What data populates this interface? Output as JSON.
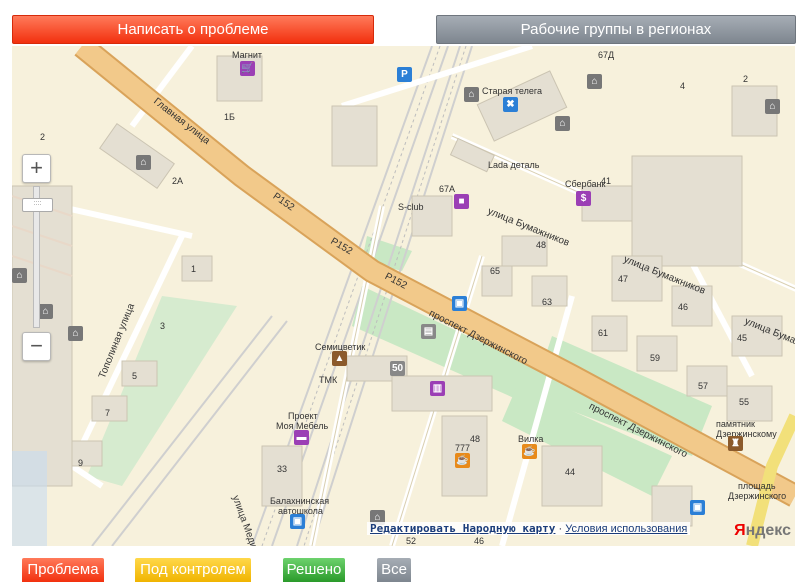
{
  "header": {
    "report_button": "Написать о проблеме",
    "groups_button": "Рабочие группы в регионах"
  },
  "map": {
    "places": {
      "magnit": "Магнит",
      "staraya_telega": "Старая телега",
      "lada": "Lada деталь",
      "sberbank": "Сбербанк",
      "sclub": "S-club",
      "semitsvetik": "Семицветик",
      "tmk": "ТМК",
      "proekt": "Проект",
      "moya_mebel": "Моя Мебель",
      "vilka": "Вилка",
      "avtoshkola_1": "Балахнинская",
      "avtoshkola_2": "автошкола",
      "pamyatnik_1": "памятник",
      "pamyatnik_2": "Дзержинскому",
      "ploshad_1": "площадь",
      "ploshad_2": "Дзержинского"
    },
    "streets": {
      "glavnaya": "Главная улица",
      "r152_a": "Р152",
      "r152_b": "Р152",
      "r152_c": "Р152",
      "bumazhnikov_a": "улица Бумажников",
      "bumazhnikov_b": "улица Бумажников",
      "bumazhnikov_c": "улица Бумажников",
      "dzerzhinskogo_a": "проспект Дзержинского",
      "dzerzhinskogo_b": "проспект Дзержинского",
      "topolinaya": "Тополиная улица",
      "medikov": "улица Медиков"
    },
    "house_numbers": [
      "67Д",
      "2",
      "4",
      "1Б",
      "2",
      "2А",
      "67А",
      "41",
      "48",
      "65",
      "47",
      "46",
      "63",
      "45",
      "61",
      "59",
      "57",
      "55",
      "1",
      "3",
      "5",
      "7",
      "9",
      "777",
      "48",
      "44",
      "33",
      "52",
      "46"
    ],
    "poi_colors": {
      "shop": "#9b3fb5",
      "service": "#2b7fd6",
      "bank": "#9b3fb5",
      "food": "#e88a1a",
      "education": "#8b5a2b",
      "parking": "#2b7fd6",
      "monument": "#8b5a2b"
    },
    "footer": {
      "edit_link": "Редактировать Народную карту",
      "separator": "·",
      "terms_link": "Условия использования",
      "logo_y": "Я",
      "logo_rest": "ндекс"
    }
  },
  "legend": {
    "problem": "Проблема",
    "control": "Под контролем",
    "solved": "Решено",
    "all": "Все"
  },
  "colors": {
    "report_red": "#f2300e",
    "groups_gray": "#7e868f",
    "control_yellow": "#f0b400",
    "solved_green": "#2a9a2a",
    "main_road": "#f2c98a",
    "map_bg": "#f7f1dc"
  }
}
